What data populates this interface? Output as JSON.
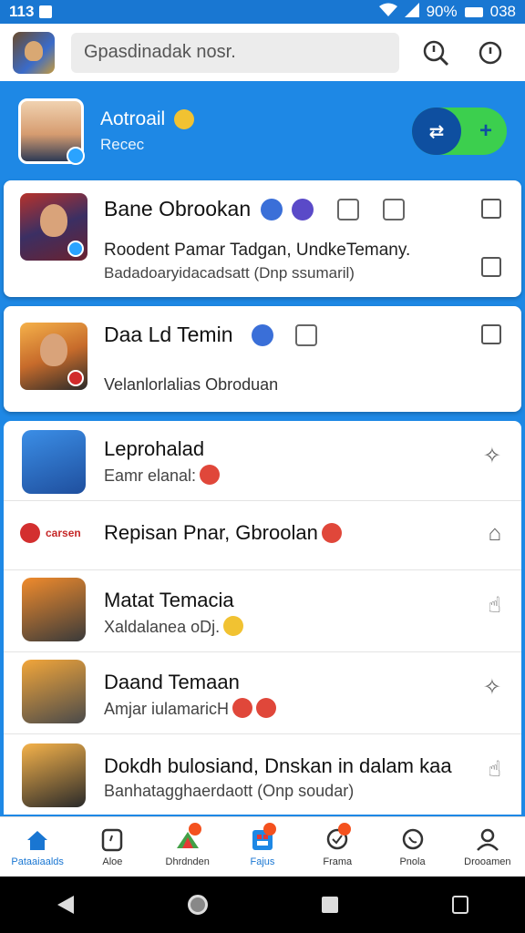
{
  "status_bar": {
    "time": "113",
    "battery": "90%",
    "right_text": "038"
  },
  "top_bar": {
    "search_placeholder": "Gpasdinadak nosr."
  },
  "profile": {
    "name": "Aotroail",
    "subtitle": "Recec"
  },
  "cards": [
    {
      "title": "Bane Obrookan",
      "line1": "Roodent Pamar Tadgan, UndkeTemany.",
      "line2": "Badadoaryidacadsatt (Dnp ssumaril)"
    },
    {
      "title": "Daa Ld Temin",
      "line1": "Velanlorlalias Obroduan"
    }
  ],
  "list": [
    {
      "title": "Leprohalad",
      "sub": "Eamr elanal:"
    },
    {
      "chip": "carsen",
      "title": "Repisan Pnar, Gbroolan"
    },
    {
      "title": "Matat Temacia",
      "sub": "Xaldalanea oDj."
    },
    {
      "title": "Daand Temaan",
      "sub": "Amjar iulamaricH"
    },
    {
      "title": "Dokdh bulosiand, Dnskan in  dalam kaa",
      "sub": "Banhatagghaerdaott (Onp soudar)"
    }
  ],
  "bottom_nav": [
    {
      "label": "Pataaiaalds",
      "icon": "home-icon",
      "active": true
    },
    {
      "label": "Aloe",
      "icon": "clock-icon"
    },
    {
      "label": "Dhrdnden",
      "icon": "fire-icon"
    },
    {
      "label": "Fajus",
      "icon": "grid-icon",
      "active": true
    },
    {
      "label": "Frama",
      "icon": "chat-icon"
    },
    {
      "label": "Pnola",
      "icon": "phone-icon"
    },
    {
      "label": "Drooamen",
      "icon": "person-icon"
    }
  ],
  "colors": {
    "primary": "#1e88e5",
    "toggle_on": "#3ccf4e",
    "knob": "#0e4fa0"
  }
}
